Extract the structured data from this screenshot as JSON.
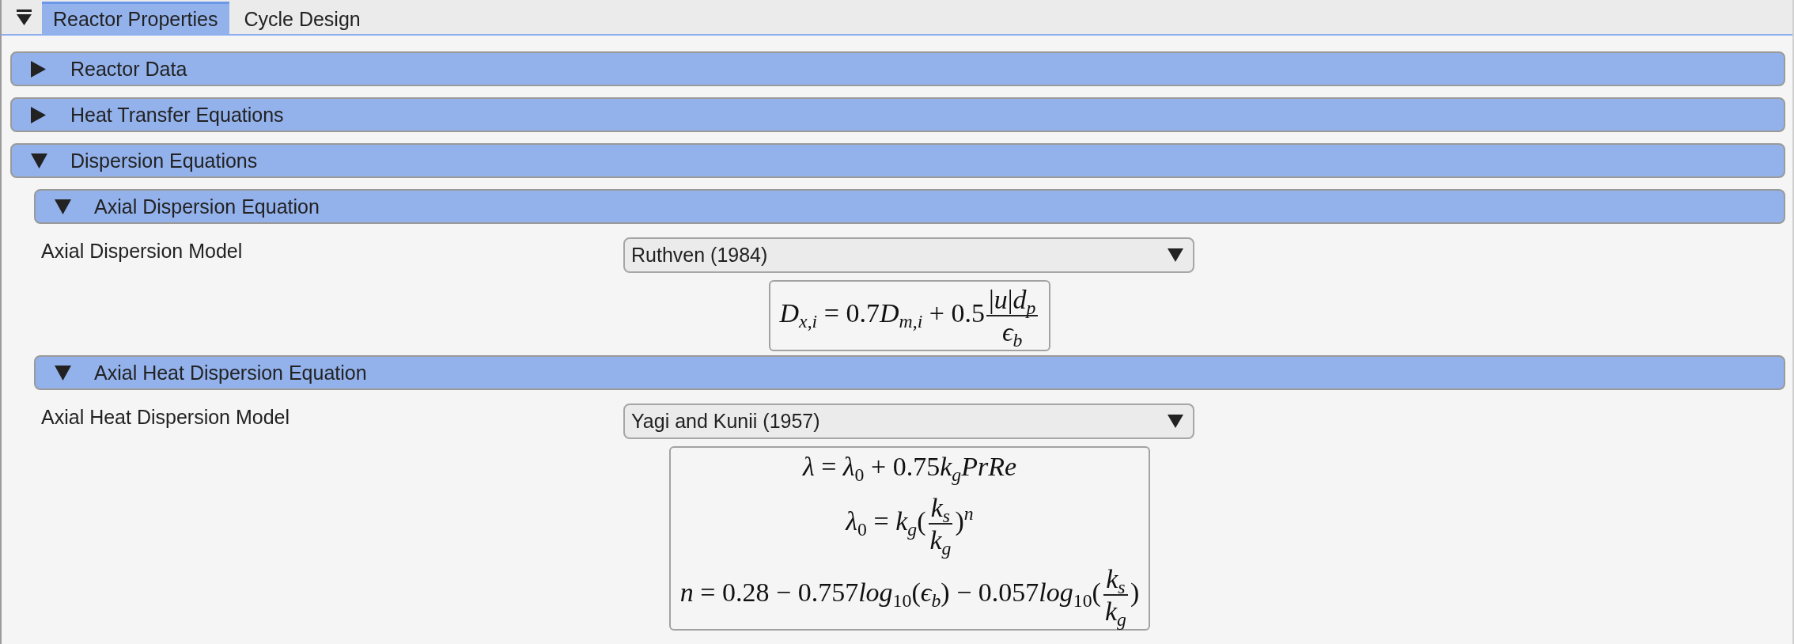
{
  "tab_bar": {
    "tabs": [
      {
        "label": "Reactor Properties",
        "selected": true
      },
      {
        "label": "Cycle Design",
        "selected": false
      }
    ]
  },
  "sections": [
    {
      "title": "Reactor Data",
      "expanded": false
    },
    {
      "title": "Heat Transfer Equations",
      "expanded": false
    },
    {
      "title": "Dispersion Equations",
      "expanded": true,
      "children": [
        {
          "title": "Axial Dispersion Equation",
          "expanded": true,
          "model": {
            "label": "Axial Dispersion Model",
            "value": "Ruthven (1984)"
          },
          "equations": [
            {
              "parts": [
                {
                  "kind": "text",
                  "text": "D$_{x,i}$ = 0.7D$_{m,i}$ + 0.5"
                },
                {
                  "kind": "frac",
                  "numerator": "|u|d$_{p}$",
                  "denominator": "ϵ$_{b}$"
                }
              ]
            }
          ]
        },
        {
          "title": "Axial Heat Dispersion Equation",
          "expanded": true,
          "model": {
            "label": "Axial Heat Dispersion Model",
            "value": "Yagi and Kunii (1957)"
          },
          "equations": [
            {
              "parts": [
                {
                  "kind": "text",
                  "text": "λ = λ$_{0}$ + 0.75k$_{g}$PrRe"
                }
              ]
            },
            {
              "parts": [
                {
                  "kind": "text",
                  "text": "λ$_{0}$ = k$_{g}$("
                },
                {
                  "kind": "frac",
                  "numerator": "k$_{s}$",
                  "denominator": "k$_{g}$"
                },
                {
                  "kind": "text",
                  "text": ")$^{n}$"
                }
              ]
            },
            {
              "parts": [
                {
                  "kind": "text",
                  "text": "n = 0.28 − 0.757log$_{10}$(ϵ$_{b}$) − 0.057log$_{10}$("
                },
                {
                  "kind": "frac",
                  "numerator": "k$_{s}$",
                  "denominator": "k$_{g}$"
                },
                {
                  "kind": "text",
                  "text": ")"
                }
              ]
            }
          ]
        }
      ]
    }
  ]
}
